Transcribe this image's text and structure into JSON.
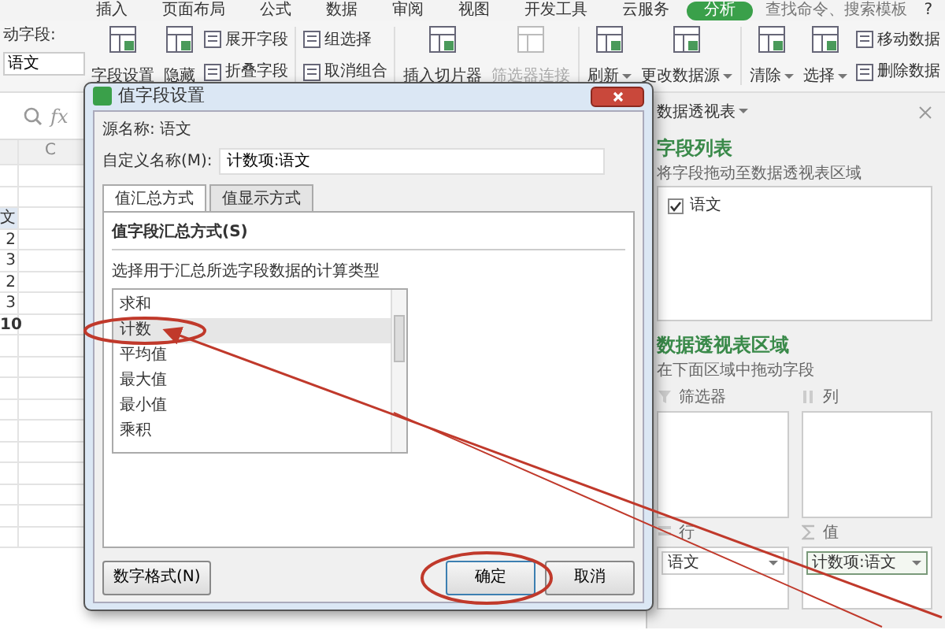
{
  "menu_tabs": [
    {
      "label": "插入",
      "selected": false
    },
    {
      "label": "页面布局",
      "selected": false
    },
    {
      "label": "公式",
      "selected": false
    },
    {
      "label": "数据",
      "selected": false
    },
    {
      "label": "审阅",
      "selected": false
    },
    {
      "label": "视图",
      "selected": false
    },
    {
      "label": "开发工具",
      "selected": false
    },
    {
      "label": "云服务",
      "selected": false
    },
    {
      "label": "分析",
      "selected": true
    }
  ],
  "search": {
    "placeholder": "查找命令、搜索模板"
  },
  "help": "?",
  "ribbon": {
    "active_field": {
      "label": "动字段:",
      "value": "语文"
    },
    "columns": [
      {
        "kind": "large",
        "label": "字段设置",
        "disabled": false,
        "dropdown": false
      },
      {
        "kind": "large",
        "label": "隐藏",
        "disabled": false,
        "dropdown": false
      },
      {
        "kind": "stack",
        "items": [
          {
            "label": "展开字段",
            "disabled": false
          },
          {
            "label": "折叠字段",
            "disabled": false
          }
        ]
      },
      {
        "kind": "separator"
      },
      {
        "kind": "stack",
        "items": [
          {
            "label": "组选择",
            "disabled": false
          },
          {
            "label": "取消组合",
            "disabled": false
          }
        ]
      },
      {
        "kind": "separator"
      },
      {
        "kind": "large",
        "label": "插入切片器",
        "disabled": false,
        "dropdown": false
      },
      {
        "kind": "large",
        "label": "筛选器连接",
        "disabled": true,
        "dropdown": false
      },
      {
        "kind": "separator"
      },
      {
        "kind": "large",
        "label": "刷新",
        "disabled": false,
        "dropdown": true
      },
      {
        "kind": "large",
        "label": "更改数据源",
        "disabled": false,
        "dropdown": true
      },
      {
        "kind": "separator"
      },
      {
        "kind": "large",
        "label": "清除",
        "disabled": false,
        "dropdown": true
      },
      {
        "kind": "large",
        "label": "选择",
        "disabled": false,
        "dropdown": true
      },
      {
        "kind": "stack",
        "items": [
          {
            "label": "移动数据",
            "disabled": false
          },
          {
            "label": "删除数据",
            "disabled": false
          }
        ]
      }
    ]
  },
  "sheet": {
    "fx": "fx",
    "column_header": "C",
    "cells": [
      {
        "text": "文",
        "bold": false
      },
      {
        "text": "2",
        "bold": false
      },
      {
        "text": "3",
        "bold": false
      },
      {
        "text": "2",
        "bold": false
      },
      {
        "text": "3",
        "bold": false
      },
      {
        "text": "10",
        "bold": true
      }
    ]
  },
  "dialog": {
    "title": "值字段设置",
    "source": "源名称: 语文",
    "custom_name_label": "自定义名称(M):",
    "custom_name_value": "计数项:语文",
    "tabs": [
      {
        "label": "值汇总方式",
        "selected": true
      },
      {
        "label": "值显示方式",
        "selected": false
      }
    ],
    "group_title": "值字段汇总方式(S)",
    "instruction": "选择用于汇总所选字段数据的计算类型",
    "functions": [
      {
        "label": "求和",
        "selected": false
      },
      {
        "label": "计数",
        "selected": true
      },
      {
        "label": "平均值",
        "selected": false
      },
      {
        "label": "最大值",
        "selected": false
      },
      {
        "label": "最小值",
        "selected": false
      },
      {
        "label": "乘积",
        "selected": false
      }
    ],
    "buttons": [
      {
        "label": "数字格式(N)",
        "kind": "left"
      },
      {
        "label": "确定",
        "kind": "default"
      },
      {
        "label": "取消",
        "kind": "right"
      }
    ]
  },
  "pivot_panel": {
    "title": "数据透视表",
    "field_list_title": "字段列表",
    "field_list_hint": "将字段拖动至数据透视表区域",
    "fields": [
      {
        "label": "语文",
        "checked": true
      }
    ],
    "areas_title": "数据透视表区域",
    "areas_hint": "在下面区域中拖动字段",
    "areas": [
      {
        "kind": "filter",
        "label": "筛选器"
      },
      {
        "kind": "columns",
        "label": "列"
      },
      {
        "kind": "rows",
        "label": "行",
        "items": [
          "语文"
        ]
      },
      {
        "kind": "values",
        "label": "值",
        "items": [
          "计数项:语文"
        ]
      }
    ]
  }
}
